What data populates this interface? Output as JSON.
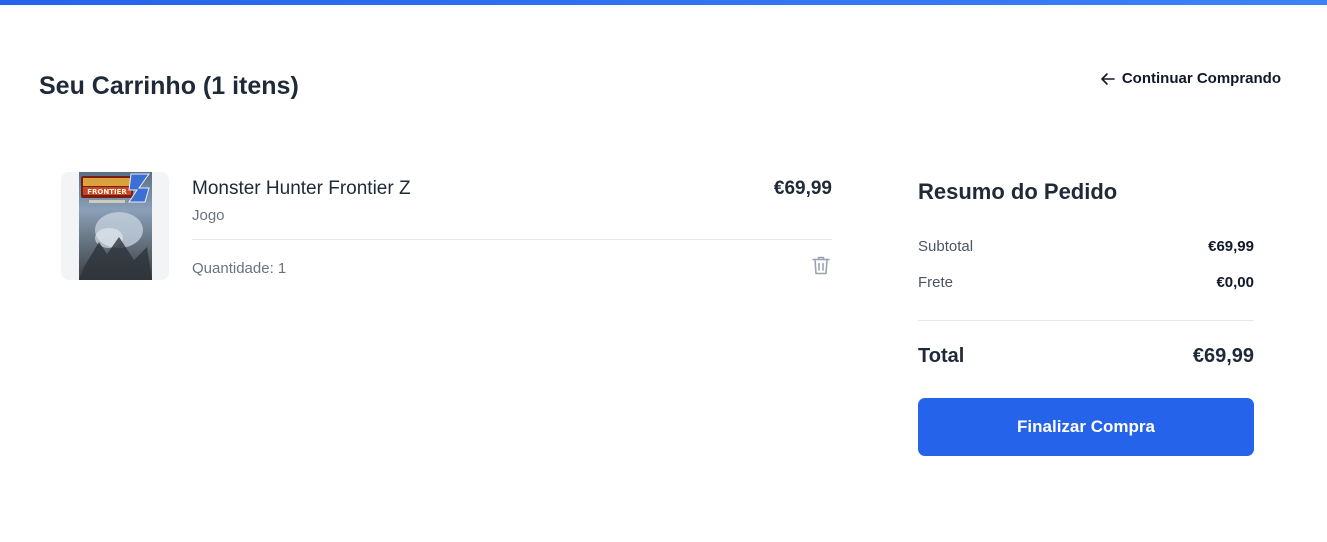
{
  "colors": {
    "accent": "#2563eb",
    "text_primary": "#1f2937",
    "text_muted": "#6b7280",
    "divider": "#e5e7eb",
    "thumb_bg": "#f3f4f6"
  },
  "header": {
    "title": "Seu Carrinho (1 itens)",
    "continue_label": "Continuar Comprando",
    "continue_icon": "arrow-left-icon"
  },
  "cart": {
    "items": [
      {
        "name": "Monster Hunter Frontier Z",
        "category": "Jogo",
        "price": "€69,99",
        "quantity_label": "Quantidade: 1",
        "image_icon": "game-cover-image",
        "remove_icon": "trash-icon"
      }
    ]
  },
  "summary": {
    "title": "Resumo do Pedido",
    "subtotal_label": "Subtotal",
    "subtotal_value": "€69,99",
    "shipping_label": "Frete",
    "shipping_value": "€0,00",
    "total_label": "Total",
    "total_value": "€69,99",
    "checkout_label": "Finalizar Compra"
  }
}
